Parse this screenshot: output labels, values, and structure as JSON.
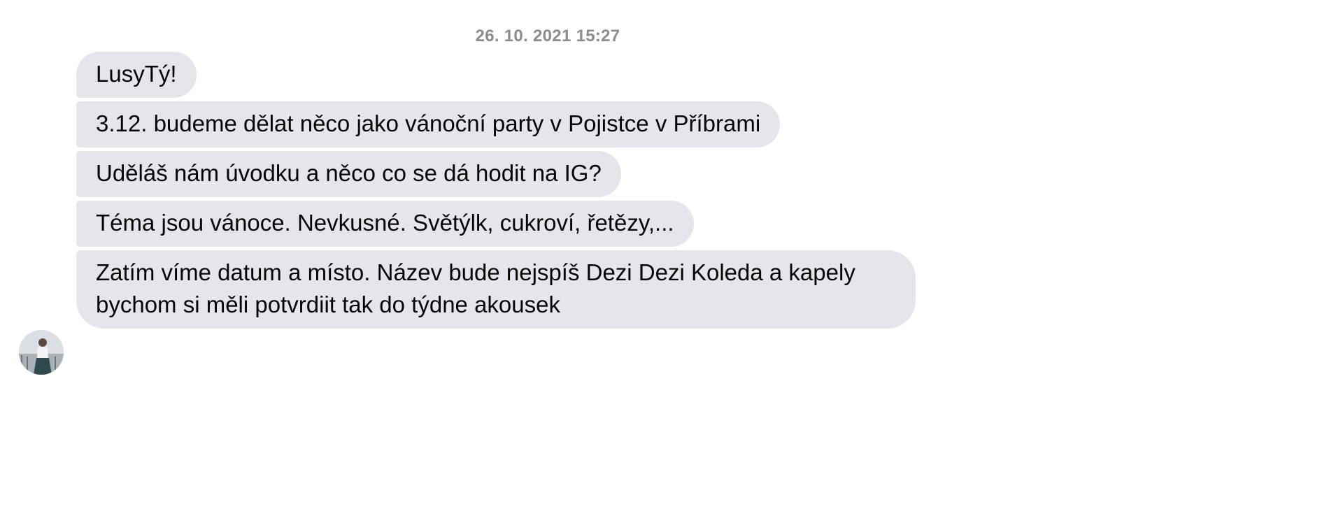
{
  "conversation": {
    "timestamp": "26. 10. 2021 15:27",
    "messages": [
      {
        "text": "LusyTý!"
      },
      {
        "text": "3.12. budeme dělat něco jako vánoční party v Pojistce v Příbrami"
      },
      {
        "text": "Uděláš nám úvodku a něco co se dá hodit na IG?"
      },
      {
        "text": "Téma jsou vánoce. Nevkusné. Světýlk, cukroví, řetězy,..."
      },
      {
        "text": "Zatím víme datum a místo. Název bude nejspíš Dezi Dezi Koleda a kapely bychom si měli potvrdiit tak do týdne akousek"
      }
    ]
  },
  "colors": {
    "bubble_bg": "#e4e6eb",
    "text": "#050505",
    "timestamp": "#8a8d91"
  },
  "icons": {
    "sender_avatar": "avatar-photo"
  }
}
